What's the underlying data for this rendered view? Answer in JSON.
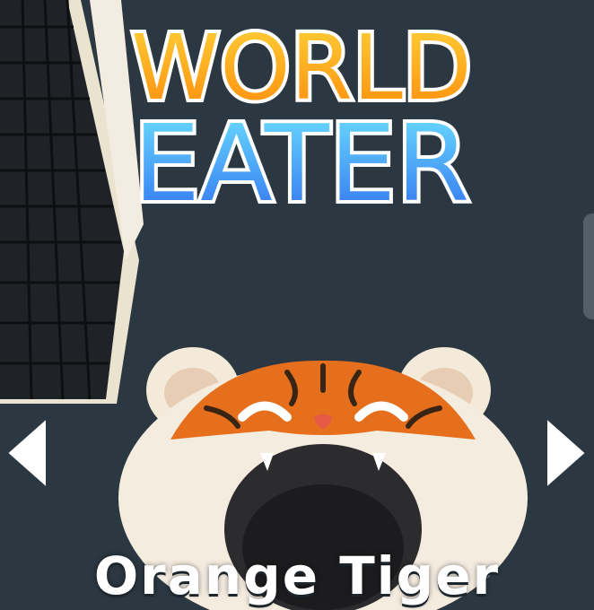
{
  "game": {
    "title_line1": "WORLD",
    "title_line2": "EATER",
    "character_name": "Orange Tiger"
  },
  "colors": {
    "background": "#2b3741",
    "title_line1_fill": "#ffb01a",
    "title_line2_fill": "#3a8ef0",
    "title_outline": "#ffffff",
    "arrow": "#ffffff"
  },
  "icons": {
    "prev": "triangle-left-icon",
    "next": "triangle-right-icon"
  }
}
